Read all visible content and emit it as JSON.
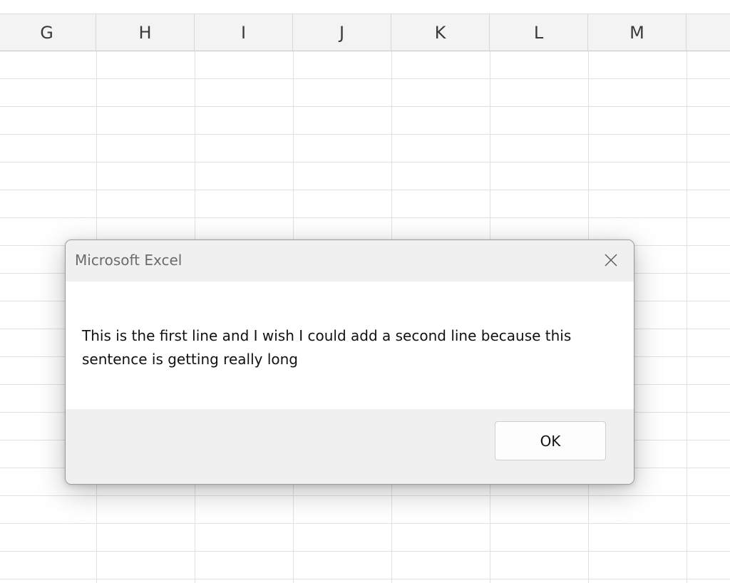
{
  "spreadsheet": {
    "columns": [
      "G",
      "H",
      "I",
      "J",
      "K",
      "L",
      "M"
    ]
  },
  "dialog": {
    "title": "Microsoft Excel",
    "message": "This is the first line and I wish I could add a second line because this sentence is getting really long",
    "ok_label": "OK",
    "close_icon": "close-icon"
  }
}
